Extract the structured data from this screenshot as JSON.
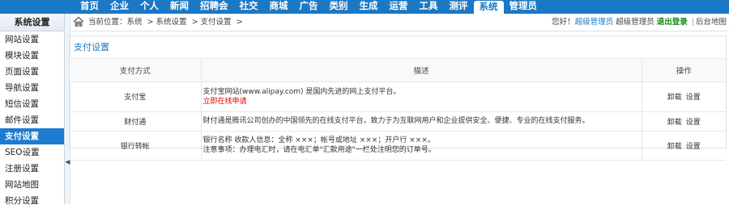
{
  "nav": {
    "items": [
      "首页",
      "企业",
      "个人",
      "新闻",
      "招聘会",
      "社交",
      "商城",
      "广告",
      "类别",
      "生成",
      "运营",
      "工具",
      "测评",
      "系统",
      "管理员"
    ],
    "active_index": 13
  },
  "sidebar": {
    "title": "系统设置",
    "items": [
      "网站设置",
      "模块设置",
      "页面设置",
      "导航设置",
      "短信设置",
      "邮件设置",
      "支付设置",
      "SEO设置",
      "注册设置",
      "网站地图",
      "积分设置"
    ],
    "active_index": 6
  },
  "breadcrumb": {
    "items": [
      "当前位置：系统",
      "> 系统设置",
      "> 支付设置",
      ">"
    ]
  },
  "user": {
    "greeting": "您好！",
    "role_link": "超级管理员",
    "role_text": "超级管理员",
    "logout": "退出登录",
    "sep": "|",
    "sitemap": "后台地图"
  },
  "panel": {
    "title": "支付设置",
    "columns": {
      "method": "支付方式",
      "desc": "描述",
      "op": "操作"
    },
    "rows": [
      {
        "method": "支付宝",
        "desc_lines": [
          "支付宝网站(www.alipay.com) 是国内先进的网上支付平台。"
        ],
        "apply_link": "立即在线申请",
        "op_uninstall": "卸载",
        "op_settings": "设置"
      },
      {
        "method": "财付通",
        "desc_lines": [
          "财付通是腾讯公司创办的中国领先的在线支付平台，致力于为互联网用户和企业提供安全、便捷、专业的在线支付服务。"
        ],
        "apply_link": "",
        "op_uninstall": "卸载",
        "op_settings": "设置"
      },
      {
        "method": "银行转帐",
        "desc_lines": [
          "银行名称 收款人信息：全称 ×××；帐号或地址 ×××；开户行 ×××。",
          "注意事项：办理电汇时，请在电汇单\"汇款用途\"一栏处注明您的订单号。"
        ],
        "apply_link": "",
        "op_uninstall": "卸载",
        "op_settings": "设置"
      }
    ]
  },
  "icons": {
    "home": "home-icon",
    "collapse": "chevron-left-icon"
  }
}
